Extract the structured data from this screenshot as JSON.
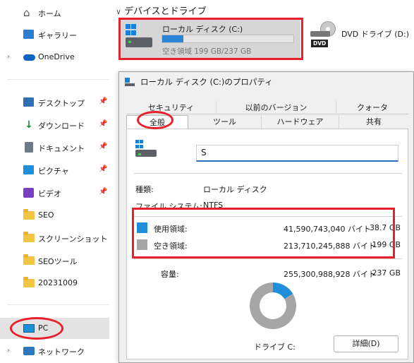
{
  "sidebar": {
    "items": [
      {
        "label": "ホーム",
        "icon": "home-icon"
      },
      {
        "label": "ギャラリー",
        "icon": "gallery-icon"
      },
      {
        "label": "OneDrive",
        "icon": "onedrive-cloud-icon"
      },
      {
        "label": "デスクトップ",
        "icon": "desktop-icon",
        "pinned": true
      },
      {
        "label": "ダウンロード",
        "icon": "download-icon",
        "pinned": true
      },
      {
        "label": "ドキュメント",
        "icon": "document-icon",
        "pinned": true
      },
      {
        "label": "ピクチャ",
        "icon": "pictures-icon",
        "pinned": true
      },
      {
        "label": "ビデオ",
        "icon": "video-icon",
        "pinned": true
      },
      {
        "label": "SEO",
        "icon": "folder-icon"
      },
      {
        "label": "スクリーンショット",
        "icon": "folder-icon"
      },
      {
        "label": "SEOツール",
        "icon": "folder-icon"
      },
      {
        "label": "20231009",
        "icon": "folder-icon"
      },
      {
        "label": "PC",
        "icon": "pc-icon",
        "selected": true
      },
      {
        "label": "ネットワーク",
        "icon": "network-icon"
      }
    ]
  },
  "drives": {
    "section_title": "デバイスとドライブ",
    "c_drive": {
      "name": "ローカル ディスク (C:)",
      "free_text": "空き領域 199 GB/237 GB",
      "used_fraction": 0.163
    },
    "dvd_drive": {
      "name": "DVD ドライブ (D:)",
      "badge": "DVD"
    }
  },
  "dialog": {
    "title": "ローカル ディスク (C:)のプロパティ",
    "tabs_row1": [
      "セキュリティ",
      "以前のバージョン",
      "クォータ"
    ],
    "tabs_row2": [
      "全般",
      "ツール",
      "ハードウェア",
      "共有"
    ],
    "active_tab": "全般",
    "volume_name": "S",
    "type_label": "種類:",
    "type_value": "ローカル ディスク",
    "fs_label": "ファイル システム:",
    "fs_value": "NTFS",
    "used": {
      "label": "使用領域:",
      "bytes": "41,590,743,040 バイト",
      "gb": "38.7 GB",
      "color": "#1f8fdc"
    },
    "free": {
      "label": "空き領域:",
      "bytes": "213,710,245,888 バイト",
      "gb": "199 GB",
      "color": "#a6a6a6"
    },
    "capacity": {
      "label": "容量:",
      "bytes": "255,300,988,928 バイト",
      "gb": "237 GB"
    },
    "drive_label": "ドライブ C:",
    "details_button": "詳細(D)"
  },
  "colors": {
    "accent": "#2a83d8",
    "annotation": "#e8202a"
  }
}
